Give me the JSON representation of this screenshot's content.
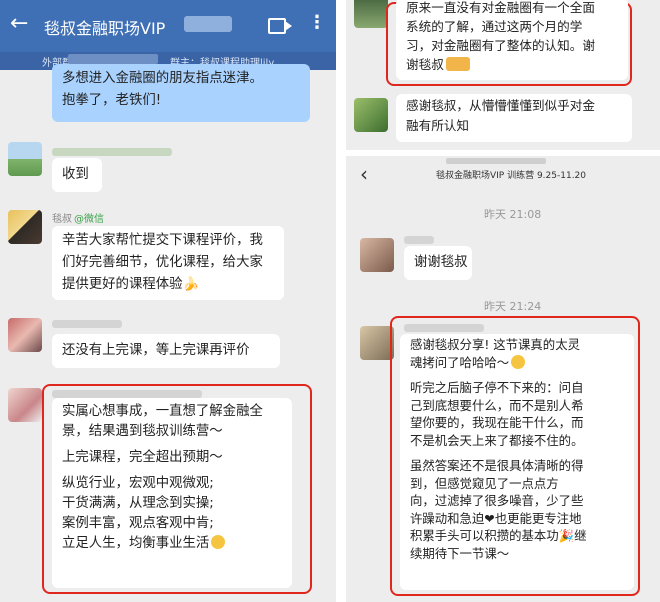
{
  "left": {
    "header": {
      "title": "毯叔金融职场VIP",
      "back_icon": "arrow-left-icon",
      "video_icon": "video-call-icon",
      "more_icon": "more-vert-icon",
      "subtitle_prefix": "外部群",
      "subtitle_suffix": "群主：毯叔课程助理lily"
    },
    "messages": [
      {
        "lines": [
          "多想进入金融圈的朋友指点迷津。",
          "抱拳了，老铁们!"
        ]
      },
      {
        "lines": [
          "收到"
        ]
      },
      {
        "name": "毯叔",
        "tag": "@微信",
        "lines": [
          "辛苦大家帮忙提交下课程评价，我",
          "们好完善细节，优化课程，给大家",
          "提供更好的课程体验🍌"
        ]
      },
      {
        "lines": [
          "还没有上完课，等上完课再评价"
        ]
      },
      {
        "lines": [
          "实属心想事成，一直想了解金融全",
          "景，结果遇到毯叔训练营～",
          "",
          "上完课程，完全超出预期～",
          "",
          "纵览行业，宏观中观微观;",
          "干货满满，从理念到实操;",
          "案例丰富，观点客观中肯;",
          "立足人生，均衡事业生活"
        ]
      }
    ]
  },
  "right_top": {
    "messages": [
      {
        "lines": [
          "原来一直没有对金融圈有一个全面",
          "系统的了解，通过这两个月的学",
          "习，对金融圈有了整体的认知。谢",
          "谢毯叔"
        ]
      },
      {
        "lines": [
          "感谢毯叔，从懵懵懂懂到似乎对金",
          "融有所认知"
        ]
      }
    ]
  },
  "right_bottom": {
    "header": {
      "title": "毯叔金融职场VIP 训练营 9.25-11.20",
      "back_icon": "chevron-left-icon"
    },
    "time1": "昨天 21:08",
    "msg1": "谢谢毯叔",
    "time2": "昨天 21:24",
    "msg2_lines": [
      "感谢毯叔分享!  这节课真的太灵",
      "魂拷问了哈哈哈～",
      "",
      "听完之后脑子停不下来的：问自",
      "己到底想要什么，而不是别人希",
      "望你要的，我现在能干什么，而",
      "不是机会天上来了都接不住的。",
      "",
      "虽然答案还不是很具体清晰的得",
      "到，但感觉窥见了一点点方",
      "向，过滤掉了很多噪音，少了些",
      "许躁动和急迫❤也更能更专注地",
      "积累手头可以积攒的基本功🎉继",
      "续期待下一节课～"
    ]
  },
  "colors": {
    "header_blue": "#3f6fb4",
    "highlight_red": "#e0271d",
    "chat_bg": "#ededed",
    "own_bubble": "#a9d2ff"
  }
}
